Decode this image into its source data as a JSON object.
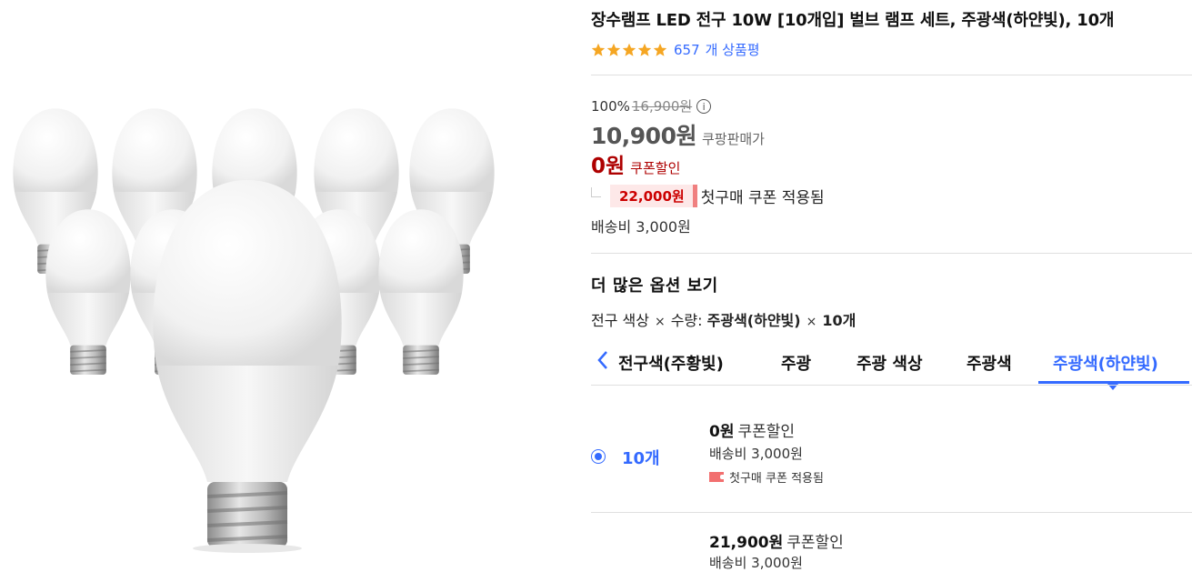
{
  "product": {
    "title": "장수램프 LED 전구 10W [10개입] 벌브 램프 세트, 주광색(하얀빛), 10개",
    "review_count": "657",
    "review_suffix": "개 상품평",
    "stars": 5
  },
  "price": {
    "discount_rate": "100%",
    "original_price": "16,900원",
    "sale_price": "10,900원",
    "sale_label": "쿠팡판매가",
    "coupon_price": "0원",
    "coupon_label": "쿠폰할인",
    "first_purchase_price": "22,000원",
    "first_purchase_label": "첫구매 쿠폰 적용됨",
    "shipping": "배송비 3,000원"
  },
  "options": {
    "section_title": "더 많은 옵션 보기",
    "selected_dims": "전구 색상",
    "selected_qty_label": "수량:",
    "selected_value": "주광색(하얀빛)",
    "selected_qty": "10개",
    "tabs": [
      {
        "label": "전구색(주황빛)"
      },
      {
        "label": "주광"
      },
      {
        "label": "주광 색상"
      },
      {
        "label": "주광색"
      },
      {
        "label": "주광색(하얀빛)"
      }
    ],
    "items": [
      {
        "name": "10개",
        "price": "0원",
        "price_label": "쿠폰할인",
        "shipping": "배송비 3,000원",
        "first_label": "첫구매 쿠폰 적용됨"
      },
      {
        "name": "",
        "price": "21,900원",
        "price_label": "쿠폰할인",
        "shipping": "배송비 3,000원"
      }
    ]
  },
  "colors": {
    "accent": "#346aff",
    "coupon": "#ae0000",
    "star": "#f5a623"
  }
}
